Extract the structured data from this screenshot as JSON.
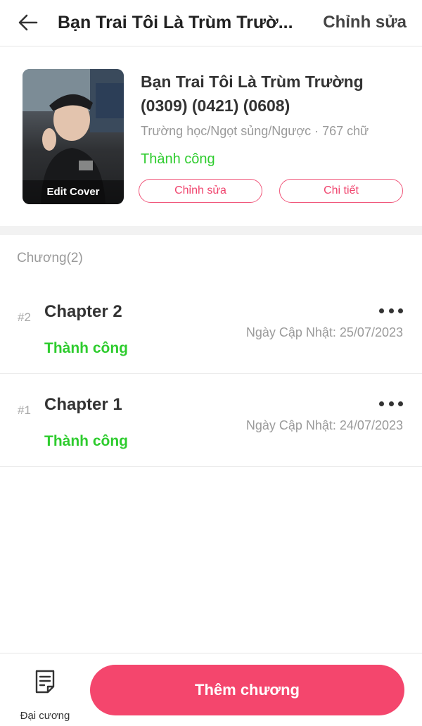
{
  "header": {
    "title": "Bạn Trai Tôi Là Trùm Trườ...",
    "edit_label": "Chỉnh sửa",
    "back_icon": "arrow-left-icon"
  },
  "book": {
    "cover_label": "Edit Cover",
    "title": "Bạn Trai Tôi Là Trùm Trường (0309) (0421) (0608)",
    "meta": "Trường học/Ngọt sủng/Ngược · 767 chữ",
    "status": "Thành công",
    "edit_button": "Chỉnh sửa",
    "detail_button": "Chi tiết"
  },
  "chapters": {
    "heading": "Chương(2)",
    "items": [
      {
        "number": "#2",
        "title": "Chapter 2",
        "updated": "Ngày Cập Nhật: 25/07/2023",
        "status": "Thành công"
      },
      {
        "number": "#1",
        "title": "Chapter 1",
        "updated": "Ngày Cập Nhật: 24/07/2023",
        "status": "Thành công"
      }
    ]
  },
  "bottom": {
    "outline_label": "Đại cương",
    "outline_icon": "document-list-icon",
    "add_button": "Thêm chương"
  },
  "colors": {
    "accent": "#f4466d",
    "success": "#2ecc2e",
    "muted": "#9a9a9a"
  }
}
